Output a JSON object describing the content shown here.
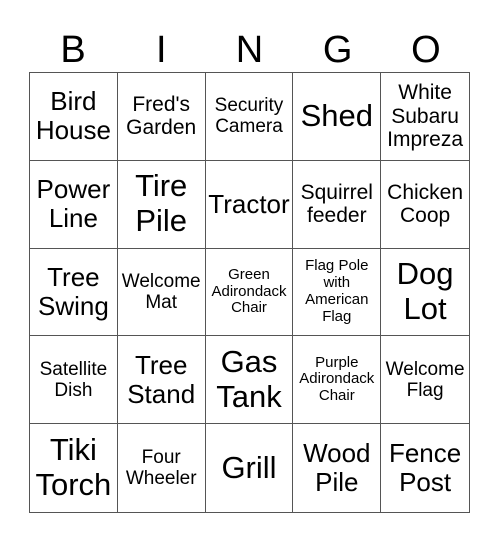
{
  "header": {
    "letters": [
      "B",
      "I",
      "N",
      "G",
      "O"
    ]
  },
  "board": {
    "rows": [
      [
        "Bird House",
        "Fred's Garden",
        "Security Camera",
        "Shed",
        "White Subaru Impreza"
      ],
      [
        "Power Line",
        "Tire Pile",
        "Tractor",
        "Squirrel feeder",
        "Chicken Coop"
      ],
      [
        "Tree Swing",
        "Welcome Mat",
        "Green Adirondack Chair",
        "Flag Pole with American Flag",
        "Dog Lot"
      ],
      [
        "Satellite Dish",
        "Tree Stand",
        "Gas Tank",
        "Purple Adirondack Chair",
        "Welcome Flag"
      ],
      [
        "Tiki Torch",
        "Four Wheeler",
        "Grill",
        "Wood Pile",
        "Fence Post"
      ]
    ]
  }
}
